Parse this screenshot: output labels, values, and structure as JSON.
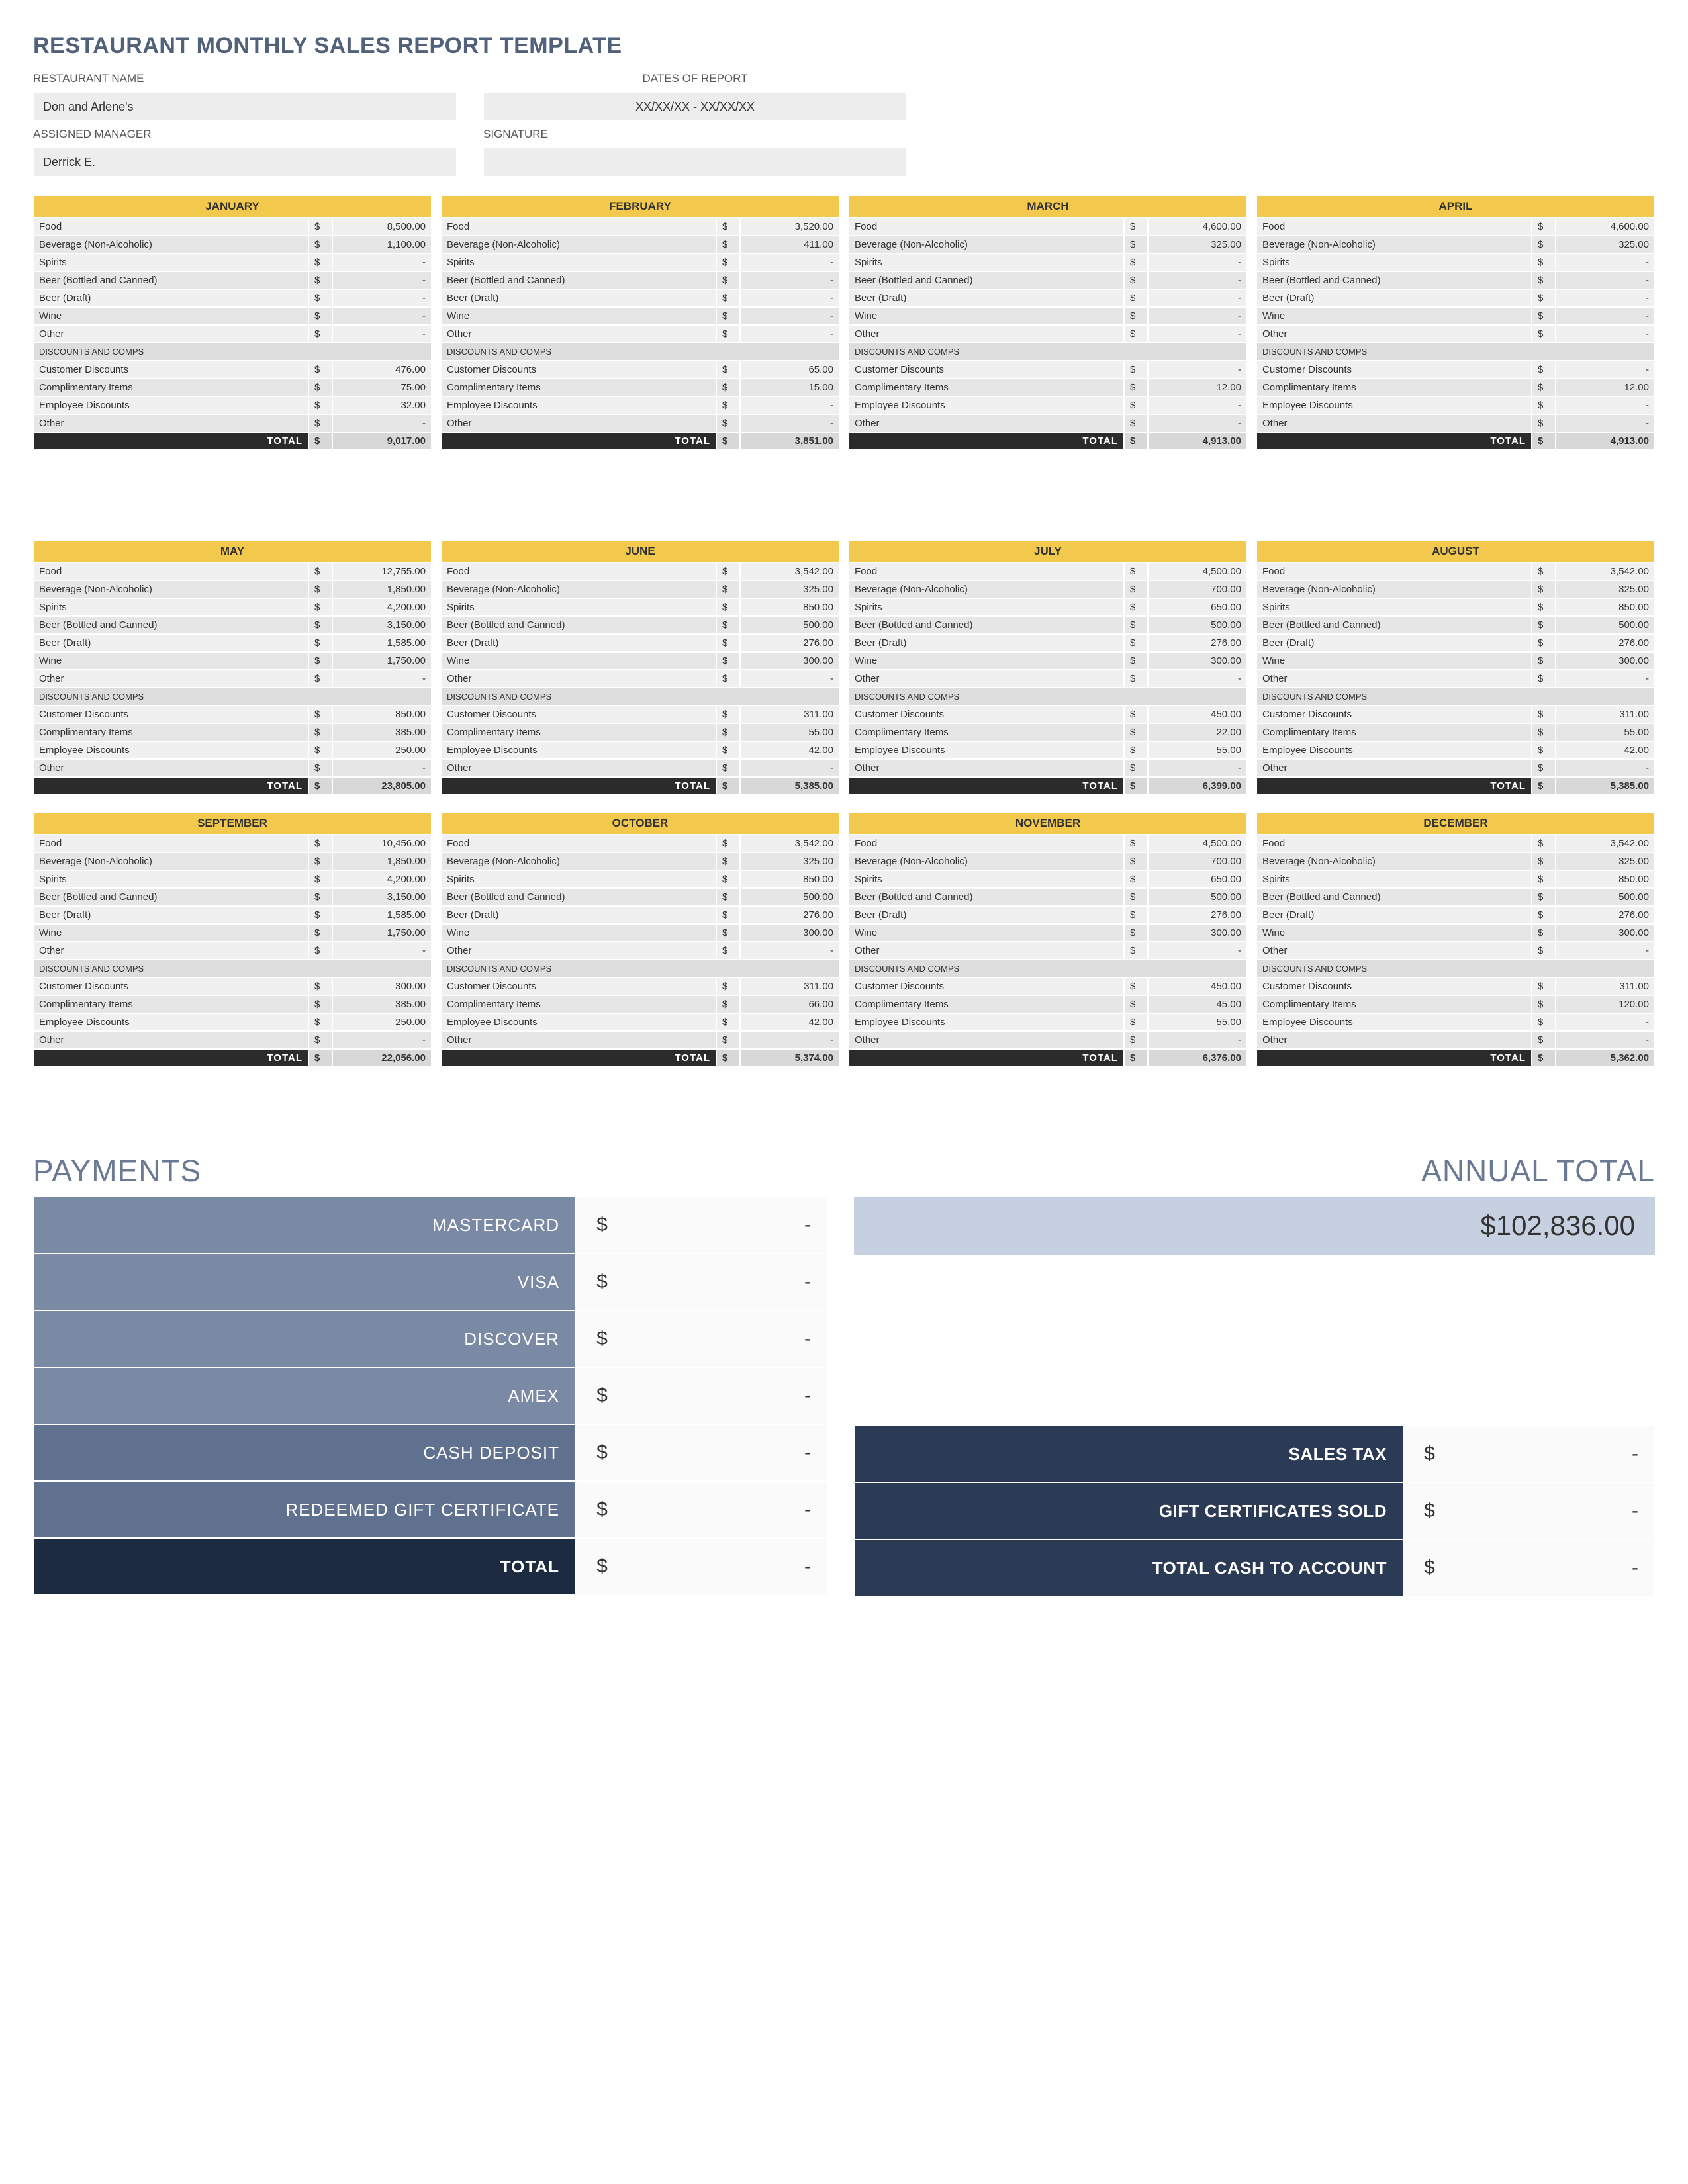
{
  "title": "RESTAURANT MONTHLY SALES REPORT TEMPLATE",
  "labels": {
    "restaurant_name": "RESTAURANT NAME",
    "dates_of_report": "DATES OF REPORT",
    "assigned_manager": "ASSIGNED MANAGER",
    "signature": "SIGNATURE",
    "discounts_comps": "DISCOUNTS AND COMPS",
    "total": "TOTAL",
    "currency": "$",
    "dash": "-"
  },
  "header": {
    "restaurant_name": "Don and Arlene's",
    "dates_of_report": "XX/XX/XX - XX/XX/XX",
    "assigned_manager": "Derrick E.",
    "signature": ""
  },
  "category_labels": {
    "food": "Food",
    "bev": "Beverage (Non-Alcoholic)",
    "spirits": "Spirits",
    "beer_bc": "Beer (Bottled and Canned)",
    "beer_draft": "Beer (Draft)",
    "wine": "Wine",
    "other": "Other",
    "cust_disc": "Customer Discounts",
    "comp_items": "Complimentary Items",
    "emp_disc": "Employee Discounts",
    "other2": "Other"
  },
  "months": [
    {
      "name": "JANUARY",
      "food": "8,500.00",
      "bev": "1,100.00",
      "spirits": "-",
      "beer_bc": "-",
      "beer_draft": "-",
      "wine": "-",
      "other": "-",
      "cust_disc": "476.00",
      "comp_items": "75.00",
      "emp_disc": "32.00",
      "other2": "-",
      "total": "9,017.00"
    },
    {
      "name": "FEBRUARY",
      "food": "3,520.00",
      "bev": "411.00",
      "spirits": "-",
      "beer_bc": "-",
      "beer_draft": "-",
      "wine": "-",
      "other": "-",
      "cust_disc": "65.00",
      "comp_items": "15.00",
      "emp_disc": "-",
      "other2": "-",
      "total": "3,851.00"
    },
    {
      "name": "MARCH",
      "food": "4,600.00",
      "bev": "325.00",
      "spirits": "-",
      "beer_bc": "-",
      "beer_draft": "-",
      "wine": "-",
      "other": "-",
      "cust_disc": "-",
      "comp_items": "12.00",
      "emp_disc": "-",
      "other2": "-",
      "total": "4,913.00"
    },
    {
      "name": "APRIL",
      "food": "4,600.00",
      "bev": "325.00",
      "spirits": "-",
      "beer_bc": "-",
      "beer_draft": "-",
      "wine": "-",
      "other": "-",
      "cust_disc": "-",
      "comp_items": "12.00",
      "emp_disc": "-",
      "other2": "-",
      "total": "4,913.00"
    },
    {
      "name": "MAY",
      "food": "12,755.00",
      "bev": "1,850.00",
      "spirits": "4,200.00",
      "beer_bc": "3,150.00",
      "beer_draft": "1,585.00",
      "wine": "1,750.00",
      "other": "-",
      "cust_disc": "850.00",
      "comp_items": "385.00",
      "emp_disc": "250.00",
      "other2": "-",
      "total": "23,805.00"
    },
    {
      "name": "JUNE",
      "food": "3,542.00",
      "bev": "325.00",
      "spirits": "850.00",
      "beer_bc": "500.00",
      "beer_draft": "276.00",
      "wine": "300.00",
      "other": "-",
      "cust_disc": "311.00",
      "comp_items": "55.00",
      "emp_disc": "42.00",
      "other2": "-",
      "total": "5,385.00"
    },
    {
      "name": "JULY",
      "food": "4,500.00",
      "bev": "700.00",
      "spirits": "650.00",
      "beer_bc": "500.00",
      "beer_draft": "276.00",
      "wine": "300.00",
      "other": "-",
      "cust_disc": "450.00",
      "comp_items": "22.00",
      "emp_disc": "55.00",
      "other2": "-",
      "total": "6,399.00"
    },
    {
      "name": "AUGUST",
      "food": "3,542.00",
      "bev": "325.00",
      "spirits": "850.00",
      "beer_bc": "500.00",
      "beer_draft": "276.00",
      "wine": "300.00",
      "other": "-",
      "cust_disc": "311.00",
      "comp_items": "55.00",
      "emp_disc": "42.00",
      "other2": "-",
      "total": "5,385.00"
    },
    {
      "name": "SEPTEMBER",
      "food": "10,456.00",
      "bev": "1,850.00",
      "spirits": "4,200.00",
      "beer_bc": "3,150.00",
      "beer_draft": "1,585.00",
      "wine": "1,750.00",
      "other": "-",
      "cust_disc": "300.00",
      "comp_items": "385.00",
      "emp_disc": "250.00",
      "other2": "-",
      "total": "22,056.00"
    },
    {
      "name": "OCTOBER",
      "food": "3,542.00",
      "bev": "325.00",
      "spirits": "850.00",
      "beer_bc": "500.00",
      "beer_draft": "276.00",
      "wine": "300.00",
      "other": "-",
      "cust_disc": "311.00",
      "comp_items": "66.00",
      "emp_disc": "42.00",
      "other2": "-",
      "total": "5,374.00"
    },
    {
      "name": "NOVEMBER",
      "food": "4,500.00",
      "bev": "700.00",
      "spirits": "650.00",
      "beer_bc": "500.00",
      "beer_draft": "276.00",
      "wine": "300.00",
      "other": "-",
      "cust_disc": "450.00",
      "comp_items": "45.00",
      "emp_disc": "55.00",
      "other2": "-",
      "total": "6,376.00"
    },
    {
      "name": "DECEMBER",
      "food": "3,542.00",
      "bev": "325.00",
      "spirits": "850.00",
      "beer_bc": "500.00",
      "beer_draft": "276.00",
      "wine": "300.00",
      "other": "-",
      "cust_disc": "311.00",
      "comp_items": "120.00",
      "emp_disc": "-",
      "other2": "-",
      "total": "5,362.00"
    }
  ],
  "payments": {
    "title": "PAYMENTS",
    "rows": [
      {
        "label": "MASTERCARD",
        "value": "-",
        "style": "light"
      },
      {
        "label": "VISA",
        "value": "-",
        "style": "light"
      },
      {
        "label": "DISCOVER",
        "value": "-",
        "style": "light"
      },
      {
        "label": "AMEX",
        "value": "-",
        "style": "light"
      },
      {
        "label": "CASH DEPOSIT",
        "value": "-",
        "style": "dark"
      },
      {
        "label": "REDEEMED GIFT CERTIFICATE",
        "value": "-",
        "style": "dark"
      },
      {
        "label": "TOTAL",
        "value": "-",
        "style": "total"
      }
    ]
  },
  "annual": {
    "title": "ANNUAL TOTAL",
    "value": "$102,836.00"
  },
  "summary": [
    {
      "label": "SALES TAX",
      "value": "-"
    },
    {
      "label": "GIFT CERTIFICATES SOLD",
      "value": "-"
    },
    {
      "label": "TOTAL CASH TO ACCOUNT",
      "value": "-"
    }
  ]
}
